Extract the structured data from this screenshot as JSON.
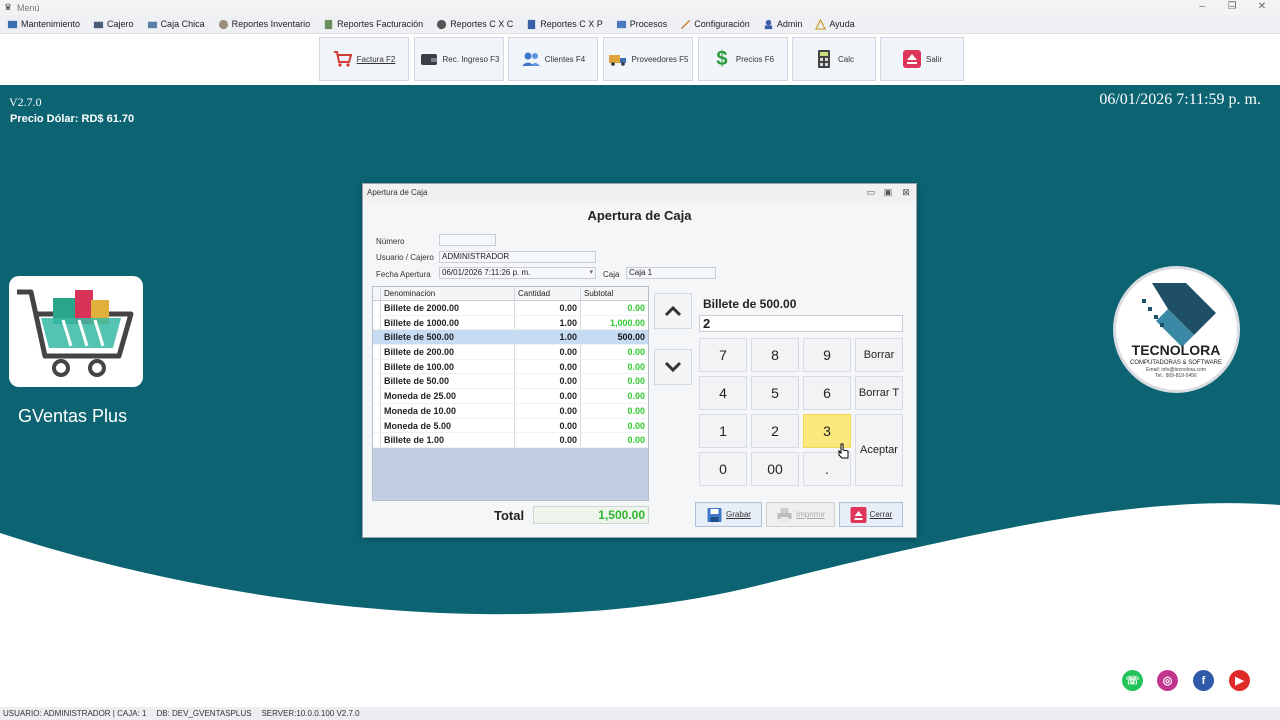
{
  "window": {
    "title": "Menú"
  },
  "menu": [
    {
      "label": "Mantenimiento",
      "icon": "folder-icon"
    },
    {
      "label": "Cajero",
      "icon": "cashier-icon"
    },
    {
      "label": "Caja Chica",
      "icon": "cashbox-icon"
    },
    {
      "label": "Reportes Inventario",
      "icon": "report-icon"
    },
    {
      "label": "Reportes Facturación",
      "icon": "report-icon"
    },
    {
      "label": "Reportes C X C",
      "icon": "report-icon"
    },
    {
      "label": "Reportes C X P",
      "icon": "report-icon"
    },
    {
      "label": "Procesos",
      "icon": "process-icon"
    },
    {
      "label": "Configuración",
      "icon": "config-icon"
    },
    {
      "label": "Admin",
      "icon": "admin-icon"
    },
    {
      "label": "Ayuda",
      "icon": "help-icon"
    }
  ],
  "toolbar": {
    "factura": "Factura F2",
    "rec_ingreso": "Rec. Ingreso F3",
    "clientes": "Clientes F4",
    "proveedores": "Proveedores  F5",
    "precios": "Precios  F6",
    "calc": "Calc",
    "salir": "Salir"
  },
  "header": {
    "version": "V2.7.0",
    "dollar_price": "Precio Dólar: RD$ 61.70",
    "datetime": "06/01/2026 7:11:59 p. m."
  },
  "brand": {
    "app_name": "GVentas Plus",
    "company": "TECNOLORA",
    "company_sub": "COMPUTADORAS & SOFTWARE",
    "company_email": "Email: info@tecnolora.com",
    "company_tel": "Tel.: 809-819-5456"
  },
  "dialog": {
    "title": "Apertura de Caja",
    "heading": "Apertura de Caja",
    "labels": {
      "numero": "Número",
      "usuario": "Usuario / Cajero",
      "fecha": "Fecha Apertura",
      "caja": "Caja"
    },
    "values": {
      "numero": "",
      "usuario": "ADMINISTRADOR",
      "fecha": "06/01/2026 7:11:26 p. m.",
      "caja": "Caja 1"
    },
    "columns": [
      "Denominacion",
      "Cantidad",
      "Subtotal"
    ],
    "rows": [
      {
        "den": "Billete de 2000.00",
        "qty": "0.00",
        "sub": "0.00"
      },
      {
        "den": "Billete de 1000.00",
        "qty": "1.00",
        "sub": "1,000.00"
      },
      {
        "den": "Billete de 500.00",
        "qty": "1.00",
        "sub": "500.00"
      },
      {
        "den": "Billete de 200.00",
        "qty": "0.00",
        "sub": "0.00"
      },
      {
        "den": "Billete de 100.00",
        "qty": "0.00",
        "sub": "0.00"
      },
      {
        "den": "Billete de 50.00",
        "qty": "0.00",
        "sub": "0.00"
      },
      {
        "den": "Moneda de 25.00",
        "qty": "0.00",
        "sub": "0.00"
      },
      {
        "den": "Moneda de 10.00",
        "qty": "0.00",
        "sub": "0.00"
      },
      {
        "den": "Moneda de 5.00",
        "qty": "0.00",
        "sub": "0.00"
      },
      {
        "den": "Billete de 1.00",
        "qty": "0.00",
        "sub": "0.00"
      }
    ],
    "total_label": "Total",
    "total_value": "1,500.00",
    "keypad": {
      "title": "Billete de 500.00",
      "display": "2",
      "keys": [
        "7",
        "8",
        "9",
        "4",
        "5",
        "6",
        "1",
        "2",
        "3",
        "0",
        "00",
        "."
      ],
      "borrar": "Borrar",
      "borrar_t": "Borrar T",
      "aceptar": "Aceptar"
    },
    "buttons": {
      "grabar": "Grabar",
      "imprimir": "Imprimir",
      "cerrar": "Cerrar"
    }
  },
  "statusbar": {
    "user": "USUARIO: ADMINISTRADOR | CAJA: 1",
    "db": "DB: DEV_GVENTASPLUS",
    "server": "SERVER:10.0.0.100  V2.7.0"
  },
  "colors": {
    "teal": "#0c6473",
    "highlight_key": "#fbe97e",
    "subtotal_green": "#2ecc2e"
  }
}
